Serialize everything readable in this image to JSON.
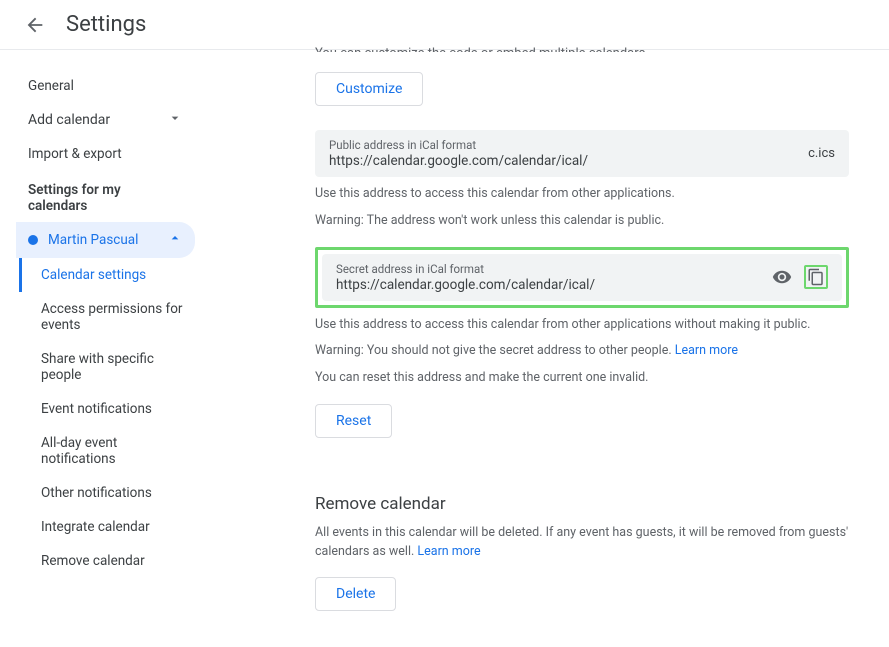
{
  "header": {
    "title": "Settings"
  },
  "sidebar": {
    "items": [
      "General",
      "Add calendar",
      "Import & export"
    ],
    "group_header": "Settings for my calendars",
    "owner": "Martin Pascual",
    "subitems": [
      "Calendar settings",
      "Access permissions for events",
      "Share with specific people",
      "Event notifications",
      "All-day event notifications",
      "Other notifications",
      "Integrate calendar",
      "Remove calendar"
    ]
  },
  "main": {
    "cutoff": "You can customize the code or embed multiple calendars.",
    "customize_btn": "Customize",
    "public_box": {
      "label": "Public address in iCal format",
      "value": "https://calendar.google.com/calendar/ical/",
      "suffix": "c.ics"
    },
    "public_help1": "Use this address to access this calendar from other applications.",
    "public_help2": "Warning: The address won't work unless this calendar is public.",
    "secret_box": {
      "label": "Secret address in iCal format",
      "value": "https://calendar.google.com/calendar/ical/"
    },
    "secret_help1": "Use this address to access this calendar from other applications without making it public.",
    "secret_help2_pre": "Warning: You should not give the secret address to other people. ",
    "secret_help2_link": "Learn more",
    "secret_help3": "You can reset this address and make the current one invalid.",
    "reset_btn": "Reset",
    "remove_title": "Remove calendar",
    "remove_desc_pre": "All events in this calendar will be deleted. If any event has guests, it will be removed from guests' calendars as well. ",
    "remove_desc_link": "Learn more",
    "delete_btn": "Delete"
  }
}
